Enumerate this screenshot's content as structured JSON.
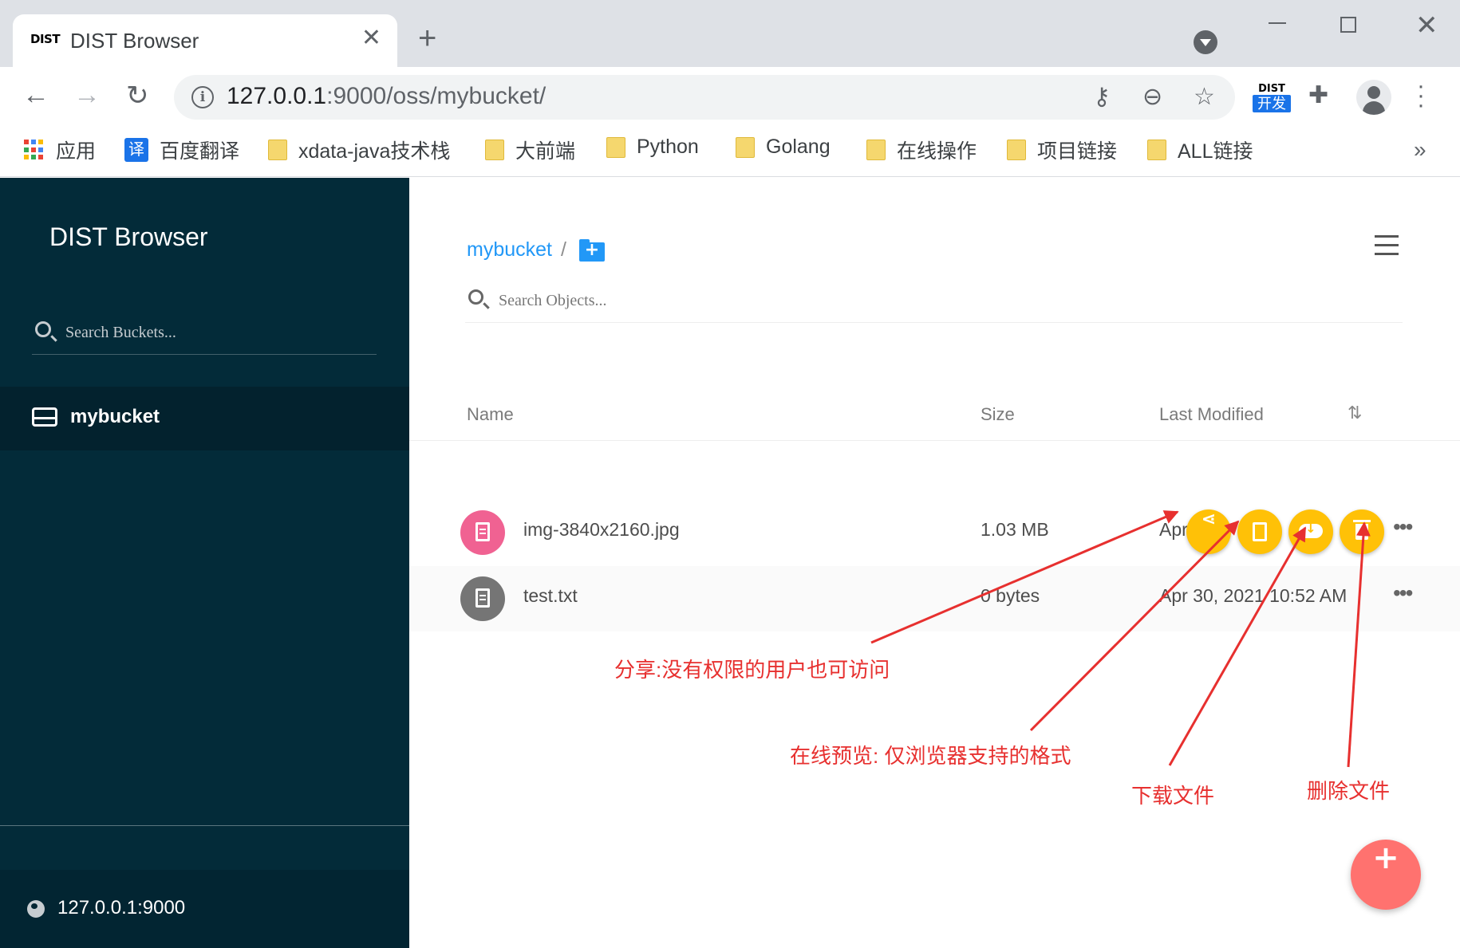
{
  "browser": {
    "tab": {
      "favicon_text": "DIST",
      "title": "DIST Browser"
    },
    "address": {
      "host": "127.0.0.1",
      "rest": ":9000/oss/mybucket/"
    },
    "extension": {
      "top": "DIST",
      "bottom": "开发"
    },
    "bookmarks": [
      {
        "label": "应用",
        "icon": "apps-grid-icon"
      },
      {
        "label": "百度翻译",
        "icon": "translate-icon",
        "icon_text": "译"
      },
      {
        "label": "xdata-java技术栈",
        "icon": "folder-icon"
      },
      {
        "label": "大前端",
        "icon": "folder-icon"
      },
      {
        "label": "Python",
        "icon": "folder-icon"
      },
      {
        "label": "Golang",
        "icon": "folder-icon"
      },
      {
        "label": "在线操作",
        "icon": "folder-icon"
      },
      {
        "label": "项目链接",
        "icon": "folder-icon"
      },
      {
        "label": "ALL链接",
        "icon": "folder-icon"
      }
    ]
  },
  "sidebar": {
    "title": "DIST Browser",
    "search_placeholder": "Search Buckets...",
    "buckets": [
      {
        "label": "mybucket",
        "icon": "drive-icon"
      }
    ],
    "footer_host": "127.0.0.1:9000"
  },
  "main": {
    "breadcrumb": {
      "bucket": "mybucket",
      "separator": "/"
    },
    "search_placeholder": "Search Objects...",
    "columns": {
      "name": "Name",
      "size": "Size",
      "modified": "Last Modified"
    },
    "rows": [
      {
        "name": "img-3840x2160.jpg",
        "size": "1.03 MB",
        "modified_visible": "Apr",
        "icon": "image-file-icon",
        "icon_color": "#f06292"
      },
      {
        "name": "test.txt",
        "size": "0 bytes",
        "modified": "Apr 30, 2021 10:52 AM",
        "icon": "text-file-icon",
        "icon_color": "#757575"
      }
    ],
    "row_actions": [
      {
        "name": "share",
        "icon": "share-icon"
      },
      {
        "name": "preview",
        "icon": "preview-icon"
      },
      {
        "name": "download",
        "icon": "download-icon"
      },
      {
        "name": "delete",
        "icon": "delete-icon"
      }
    ]
  },
  "annotations": {
    "share": "分享:没有权限的用户也可访问",
    "preview": "在线预览: 仅浏览器支持的格式",
    "download": "下载文件",
    "delete": "删除文件"
  },
  "colors": {
    "sidebar": "#032b39",
    "accent": "#2298f7",
    "action": "#ffc107",
    "fab": "#ff726f",
    "annotation": "#e7302f"
  }
}
